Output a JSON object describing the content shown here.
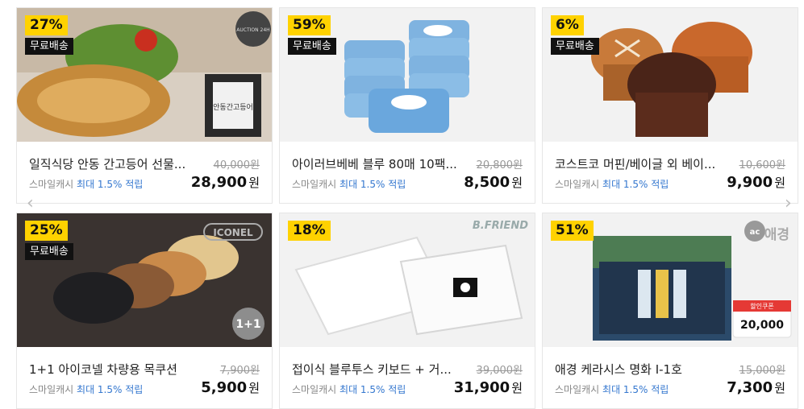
{
  "products": [
    {
      "discount": "27%",
      "free": "무료배송",
      "title": "일직식당 안동 간고등어 선물...",
      "orig": "40,000원",
      "cash_pre": "스마일캐시",
      "cash_hl": "최대 1.5% 적립",
      "price": "28,900",
      "won": "원",
      "thumb_text": "안동간고등어",
      "thumb_badge": "AUCTION 24H"
    },
    {
      "discount": "59%",
      "free": "무료배송",
      "title": "아이러브베베 블루 80매 10팩...",
      "orig": "20,800원",
      "cash_pre": "스마일캐시",
      "cash_hl": "최대 1.5% 적립",
      "price": "8,500",
      "won": "원"
    },
    {
      "discount": "6%",
      "free": "무료배송",
      "title": "코스트코 머핀/베이글 외 베이...",
      "orig": "10,600원",
      "cash_pre": "스마일캐시",
      "cash_hl": "최대 1.5% 적립",
      "price": "9,900",
      "won": "원"
    },
    {
      "discount": "25%",
      "free": "무료배송",
      "title": "1+1 아이코넬 차량용 목쿠션",
      "orig": "7,900원",
      "cash_pre": "스마일캐시",
      "cash_hl": "최대 1.5% 적립",
      "price": "5,900",
      "won": "원",
      "brand": "ICONEL",
      "promo": "1+1"
    },
    {
      "discount": "18%",
      "title": "접이식 블루투스 키보드 + 거...",
      "orig": "39,000원",
      "cash_pre": "스마일캐시",
      "cash_hl": "최대 1.5% 적립",
      "price": "31,900",
      "won": "원",
      "brand": "B.FRIEND"
    },
    {
      "discount": "51%",
      "title": "애경 케라시스 명화 I-1호",
      "orig": "15,000원",
      "cash_pre": "스마일캐시",
      "cash_hl": "최대 1.5% 적립",
      "price": "7,300",
      "won": "원",
      "brand": "애경",
      "coupon_label": "할인쿠폰",
      "coupon_value": "20,000"
    }
  ],
  "nav": {
    "prev": "‹",
    "next": "›"
  }
}
